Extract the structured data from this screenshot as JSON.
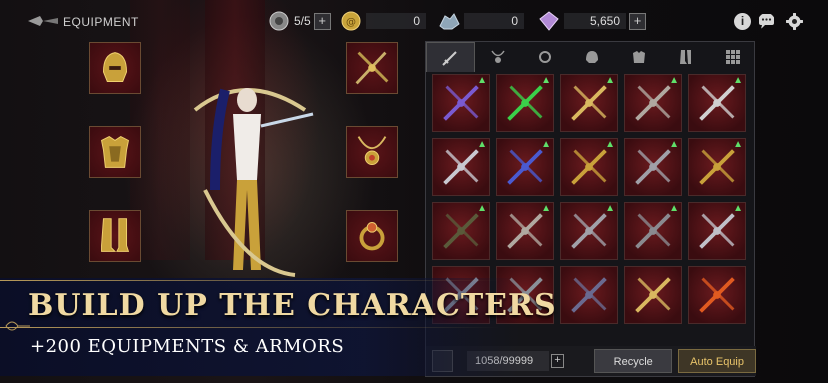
{
  "header": {
    "title": "EQUIPMENT",
    "stamina": "5/5",
    "gold": "0",
    "crystals": "0",
    "gems": "5,650"
  },
  "inventory": {
    "tabs": [
      "weapon-icon",
      "necklace-icon",
      "ring-icon",
      "helmet-icon",
      "armor-icon",
      "boots-icon",
      "all-icon"
    ],
    "capacity": "1058/99999",
    "plus": "+",
    "recycle_label": "Recycle",
    "auto_equip_label": "Auto Equip"
  },
  "banner": {
    "headline": "BUILD UP THE CHARACTERS",
    "subline": "+200 EQUIPMENTS & ARMORS"
  },
  "colors": {
    "accent_gold": "#f0d9a2",
    "upgrade_green": "#5fe06a",
    "slot_red": "#5a1418"
  }
}
